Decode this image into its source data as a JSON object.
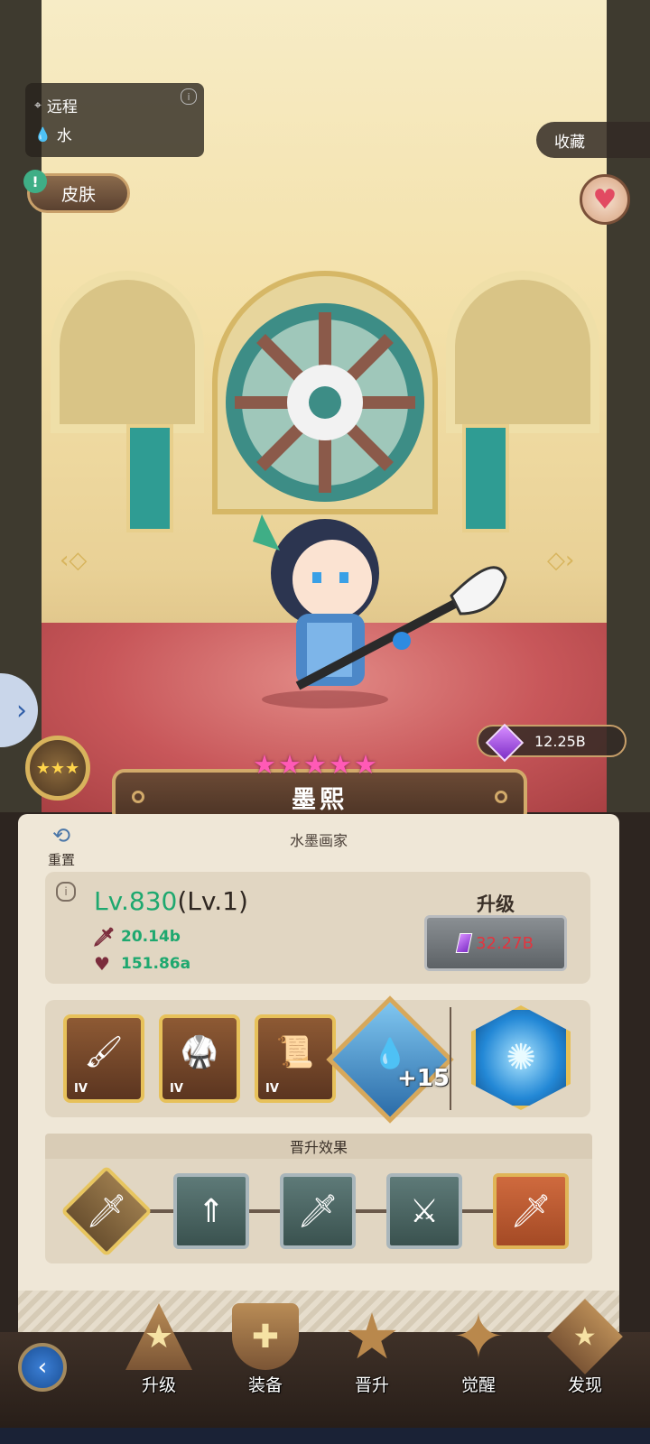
{
  "hero": {
    "type_label": "远程",
    "element_label": "水",
    "skin_button": "皮肤",
    "favorite_tab": "收藏",
    "name": "墨熙",
    "class_title": "水墨画家",
    "star_count": 5,
    "currency": "12.25B"
  },
  "panel": {
    "reset_label": "重置",
    "level_main": "Lv.830",
    "level_sub": "(Lv.1)",
    "attack_value": "20.14b",
    "hp_value": "151.86a",
    "upgrade_title": "升级",
    "upgrade_cost": "32.27B",
    "equipment": [
      {
        "name": "brush-weapon",
        "tier": "IV"
      },
      {
        "name": "armor",
        "tier": "IV"
      },
      {
        "name": "scroll",
        "tier": "IV"
      }
    ],
    "jewel_level": "+15",
    "promo_title": "晋升效果"
  },
  "nav": {
    "items": [
      "升级",
      "装备",
      "晋升",
      "觉醒",
      "发现"
    ]
  },
  "colors": {
    "level_green": "#1ea86f",
    "cost_red": "#e2353f",
    "star_pink": "#ff5ab6",
    "gold_border": "#e0b557"
  },
  "icons": [
    "ranged-icon",
    "water-drop-icon",
    "heart-icon",
    "crystal-icon",
    "sword-icon",
    "heart-stat-icon",
    "back-arrow-icon"
  ]
}
